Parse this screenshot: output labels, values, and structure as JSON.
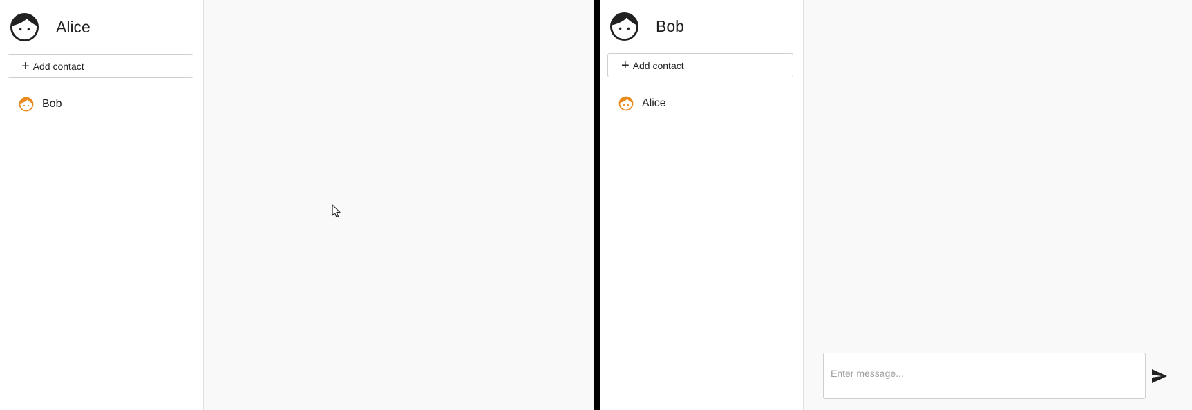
{
  "colors": {
    "sidebar_bg": "#ffffff",
    "chat_bg": "#f9f9f9",
    "divider": "#000000",
    "contact_avatar": "#e98a1c",
    "user_avatar": "#212121"
  },
  "left_pane": {
    "profile": {
      "name": "Alice",
      "avatar_icon": "face-icon"
    },
    "add_contact": {
      "icon": "plus-icon",
      "label": "Add contact"
    },
    "contacts": [
      {
        "name": "Bob",
        "avatar_icon": "face-icon"
      }
    ]
  },
  "right_pane": {
    "profile": {
      "name": "Bob",
      "avatar_icon": "face-icon"
    },
    "add_contact": {
      "icon": "plus-icon",
      "label": "Add contact"
    },
    "contacts": [
      {
        "name": "Alice",
        "avatar_icon": "face-icon"
      }
    ],
    "composer": {
      "placeholder": "Enter message...",
      "value": "",
      "send_icon": "send-icon"
    }
  }
}
